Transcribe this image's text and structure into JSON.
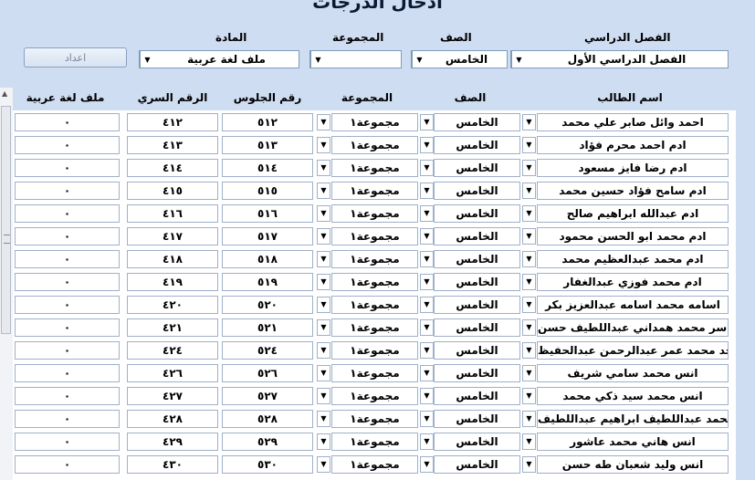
{
  "window": {
    "title": "ادخال الدرجات"
  },
  "filters": {
    "term_label": "الفصل الدراسي",
    "term_value": "الفصل الدراسي الأول",
    "grade_label": "الصف",
    "grade_value": "الخامس",
    "group_label": "المجموعة",
    "group_value": "",
    "subject_label": "المادة",
    "subject_value": "ملف لغة عربية",
    "prepare_button": "اعداد"
  },
  "columns": {
    "student_name": "اسم الطالب",
    "grade": "الصف",
    "group": "المجموعة",
    "seat_number": "رقم الجلوس",
    "secret_number": "الرقم السري",
    "subject_file": "ملف لغة عربية"
  },
  "rows": [
    {
      "name": "احمد وائل صابر علي محمد",
      "grade": "الخامس",
      "group": "مجموعة١",
      "seat": "٥١٢",
      "secret": "٤١٢",
      "score": "٠"
    },
    {
      "name": "ادم احمد محرم فؤاد",
      "grade": "الخامس",
      "group": "مجموعة١",
      "seat": "٥١٣",
      "secret": "٤١٣",
      "score": "٠"
    },
    {
      "name": "ادم رضا فايز مسعود",
      "grade": "الخامس",
      "group": "مجموعة١",
      "seat": "٥١٤",
      "secret": "٤١٤",
      "score": "٠"
    },
    {
      "name": "ادم سامح فؤاد حسين محمد",
      "grade": "الخامس",
      "group": "مجموعة١",
      "seat": "٥١٥",
      "secret": "٤١٥",
      "score": "٠"
    },
    {
      "name": "ادم عبدالله ابراهيم صالح",
      "grade": "الخامس",
      "group": "مجموعة١",
      "seat": "٥١٦",
      "secret": "٤١٦",
      "score": "٠"
    },
    {
      "name": "ادم محمد ابو الحسن محمود",
      "grade": "الخامس",
      "group": "مجموعة١",
      "seat": "٥١٧",
      "secret": "٤١٧",
      "score": "٠"
    },
    {
      "name": "ادم محمد عبدالعظيم محمد",
      "grade": "الخامس",
      "group": "مجموعة١",
      "seat": "٥١٨",
      "secret": "٤١٨",
      "score": "٠"
    },
    {
      "name": "ادم محمد فوزي عبدالغفار",
      "grade": "الخامس",
      "group": "مجموعة١",
      "seat": "٥١٩",
      "secret": "٤١٩",
      "score": "٠"
    },
    {
      "name": "اسامه محمد اسامه عبدالعزيز بكر",
      "grade": "الخامس",
      "group": "مجموعة١",
      "seat": "٥٢٠",
      "secret": "٤٢٠",
      "score": "٠"
    },
    {
      "name": "اسر محمد همداني عبداللطيف حسن",
      "grade": "الخامس",
      "group": "مجموعة١",
      "seat": "٥٢١",
      "secret": "٤٢١",
      "score": "٠"
    },
    {
      "name": "امجد محمد عمر عبدالرحمن عبدالحفيظ",
      "grade": "الخامس",
      "group": "مجموعة١",
      "seat": "٥٢٤",
      "secret": "٤٢٤",
      "score": "٠"
    },
    {
      "name": "انس محمد سامي شريف",
      "grade": "الخامس",
      "group": "مجموعة١",
      "seat": "٥٢٦",
      "secret": "٤٢٦",
      "score": "٠"
    },
    {
      "name": "انس محمد سيد ذكي محمد",
      "grade": "الخامس",
      "group": "مجموعة١",
      "seat": "٥٢٧",
      "secret": "٤٢٧",
      "score": "٠"
    },
    {
      "name": "انس محمد عبداللطيف ابراهيم عبداللطيف",
      "grade": "الخامس",
      "group": "مجموعة١",
      "seat": "٥٢٨",
      "secret": "٤٢٨",
      "score": "٠"
    },
    {
      "name": "انس هاني محمد عاشور",
      "grade": "الخامس",
      "group": "مجموعة١",
      "seat": "٥٢٩",
      "secret": "٤٢٩",
      "score": "٠"
    },
    {
      "name": "انس وليد شعبان طه حسن",
      "grade": "الخامس",
      "group": "مجموعة١",
      "seat": "٥٣٠",
      "secret": "٤٣٠",
      "score": "٠"
    }
  ]
}
